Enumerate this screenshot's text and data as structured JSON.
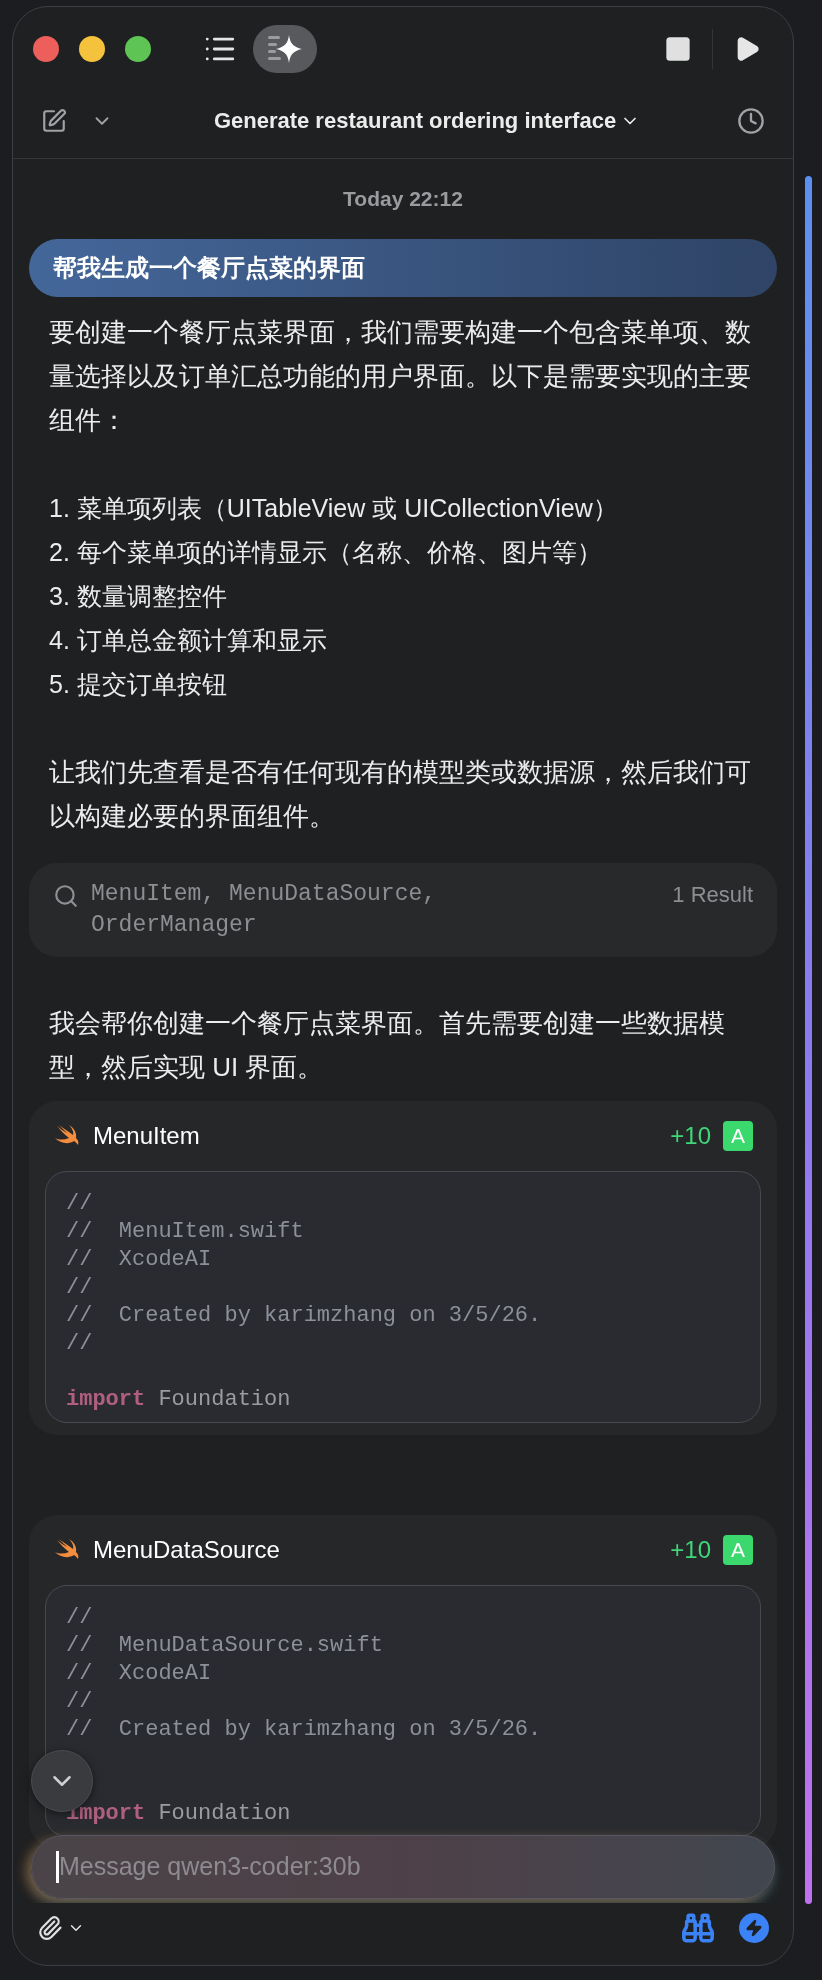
{
  "window": {
    "title": "Generate restaurant ordering interface"
  },
  "timestamp": "Today 22:12",
  "conversation": [
    {
      "kind": "user",
      "text": "帮我生成一个餐厅点菜的界面"
    },
    {
      "kind": "text",
      "text": "要创建一个餐厅点菜界面，我们需要构建一个包含菜单项、数量选择以及订单汇总功能的用户界面。以下是需要实现的主要组件："
    },
    {
      "kind": "list",
      "items": [
        "1. 菜单项列表（UITableView 或 UICollectionView）",
        "2. 每个菜单项的详情显示（名称、价格、图片等）",
        "3. 数量调整控件",
        "4. 订单总金额计算和显示",
        "5. 提交订单按钮"
      ]
    },
    {
      "kind": "text",
      "text": "让我们先查看是否有任何现有的模型类或数据源，然后我们可以构建必要的界面组件。"
    },
    {
      "kind": "search",
      "query": "MenuItem, MenuDataSource, OrderManager",
      "result": "1 Result"
    },
    {
      "kind": "text",
      "text": "我会帮你创建一个餐厅点菜界面。首先需要创建一些数据模型，然后实现 UI 界面。"
    },
    {
      "kind": "file",
      "name": "MenuItem",
      "added": "+10",
      "badge": "A",
      "header_lines": [
        "//",
        "//  MenuItem.swift",
        "//  XcodeAI",
        "//",
        "//  Created by karimzhang on 3/5/26.",
        "//"
      ],
      "keyword": "import",
      "module": "Foundation"
    },
    {
      "kind": "file",
      "name": "MenuDataSource",
      "added": "+10",
      "badge": "A",
      "header_lines": [
        "//",
        "//  MenuDataSource.swift",
        "//  XcodeAI",
        "//",
        "//  Created by karimzhang on 3/5/26."
      ],
      "keyword": "import",
      "module": "Foundation"
    }
  ],
  "input": {
    "placeholder": "Message qwen3-coder:30b"
  }
}
